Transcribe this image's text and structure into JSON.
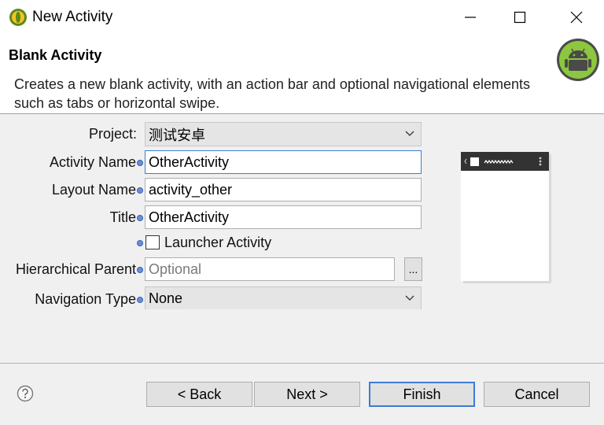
{
  "window": {
    "title": "New Activity"
  },
  "header": {
    "title": "Blank Activity",
    "description": "Creates a new blank activity, with an action bar and optional navigational elements such as tabs or horizontal swipe."
  },
  "form": {
    "project": {
      "label": "Project:",
      "value": "测试安卓"
    },
    "activity_name": {
      "label": "Activity Name",
      "value": "OtherActivity"
    },
    "layout_name": {
      "label": "Layout Name",
      "value": "activity_other"
    },
    "title": {
      "label": "Title",
      "value": "OtherActivity"
    },
    "launcher": {
      "label": "Launcher Activity",
      "checked": false
    },
    "hierarchical_parent": {
      "label": "Hierarchical Parent",
      "placeholder": "Optional",
      "browse_label": "..."
    },
    "navigation_type": {
      "label": "Navigation Type",
      "value": "None"
    }
  },
  "buttons": {
    "back": "< Back",
    "next": "Next >",
    "finish": "Finish",
    "cancel": "Cancel"
  },
  "icons": [
    "eclipse-app-icon",
    "minimize-icon",
    "maximize-icon",
    "close-icon",
    "android-logo-icon",
    "info-icon",
    "chevron-down-icon",
    "help-icon"
  ],
  "colors": {
    "accent": "#3d7bd6",
    "android_green": "#8dc63f"
  }
}
